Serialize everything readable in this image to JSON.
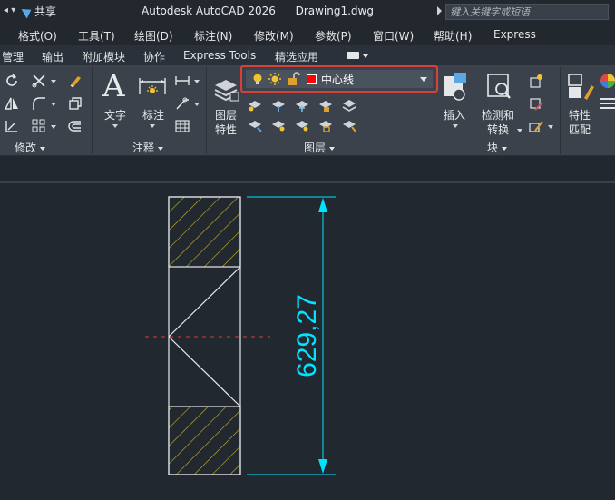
{
  "titlebar": {
    "share_label": "共享",
    "app_title": "Autodesk AutoCAD 2026",
    "doc_title": "Drawing1.dwg",
    "search_placeholder": "键入关键字或短语"
  },
  "menubar": {
    "items": [
      "格式(O)",
      "工具(T)",
      "绘图(D)",
      "标注(N)",
      "修改(M)",
      "参数(P)",
      "窗口(W)",
      "帮助(H)",
      "Express"
    ]
  },
  "ribbon_tabs": {
    "items": [
      "管理",
      "输出",
      "附加模块",
      "协作",
      "Express Tools",
      "精选应用"
    ]
  },
  "ribbon": {
    "modify_panel_title": "修改",
    "annotation_panel_title": "注释",
    "text_label": "文字",
    "dimension_label": "标注",
    "layer_props_label_1": "图层",
    "layer_props_label_2": "特性",
    "layer_panel_title": "图层",
    "insert_label": "插入",
    "detect_convert_label_1": "检测和",
    "detect_convert_label_2": "转换",
    "block_panel_title": "块",
    "match_props_label_1": "特性",
    "match_props_label_2": "匹配"
  },
  "layer_dropdown": {
    "current_layer": "中心线",
    "layer_color": "#ff0000"
  },
  "drawing": {
    "dimension_text": "629,27",
    "dimension_color": "#00e5ff",
    "hatch_color": "#c8b830",
    "centerline_color": "#e03a3a"
  }
}
